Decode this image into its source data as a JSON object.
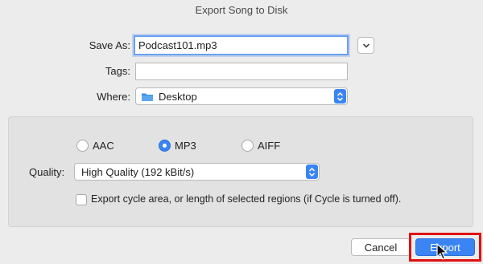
{
  "window": {
    "title": "Export Song to Disk"
  },
  "form": {
    "save_as_label": "Save As:",
    "save_as_value": "Podcast101.mp3",
    "tags_label": "Tags:",
    "tags_value": "",
    "where_label": "Where:",
    "where_value": "Desktop"
  },
  "format": {
    "options": [
      "AAC",
      "MP3",
      "AIFF"
    ],
    "selected": "MP3",
    "quality_label": "Quality:",
    "quality_value": "High Quality (192 kBit/s)",
    "cycle_checkbox_label": "Export cycle area, or length of selected regions (if Cycle is turned off).",
    "cycle_checked": false
  },
  "buttons": {
    "cancel": "Cancel",
    "export": "Export"
  },
  "colors": {
    "accent": "#3a84f4",
    "highlight_box": "#e01010",
    "folder": "#3a8ee6"
  },
  "icons": [
    "chevron-down-icon",
    "folder-icon",
    "updown-chevrons-icon",
    "mouse-cursor-icon"
  ]
}
